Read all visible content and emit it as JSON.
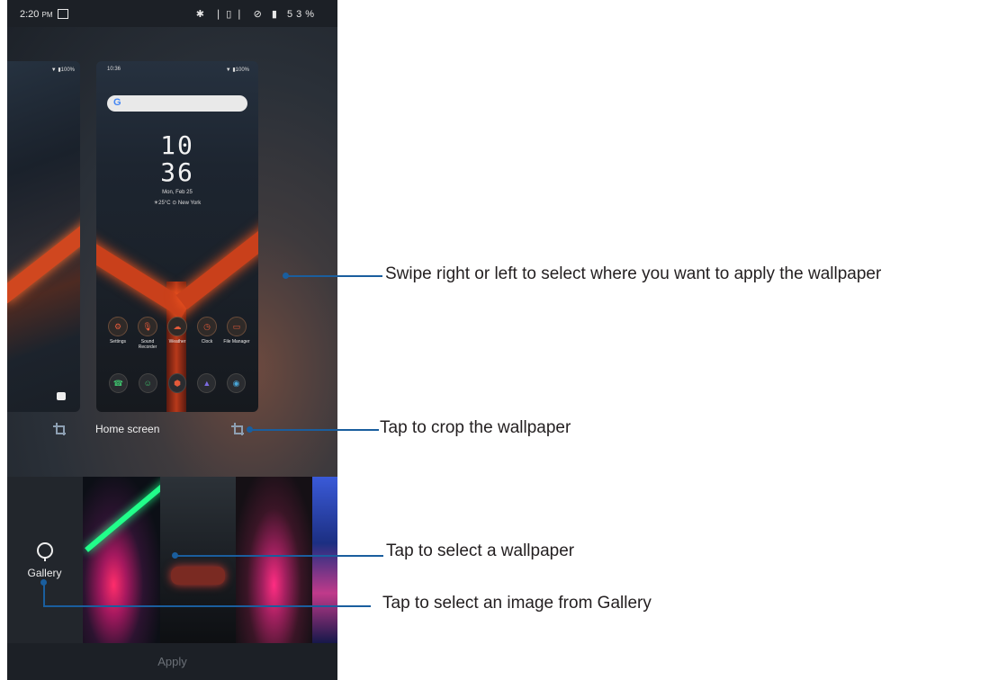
{
  "status_bar": {
    "time": "2:20",
    "ampm": "PM",
    "bluetooth": "✱",
    "vibrate": "❘▯❘",
    "no_sim": "⊘",
    "battery_pct": "53%"
  },
  "lock_preview": {
    "status": "▼ ▮100%",
    "camera_icon": "camera-icon"
  },
  "home_preview": {
    "status_time": "10:36",
    "status_right": "▼ ▮100%",
    "search_logo": "G",
    "clock_hours": "10",
    "clock_minutes": "36",
    "date": "Mon, Feb 25",
    "weather": "☀25°C ⊙ New York",
    "apps": [
      {
        "label": "Settings",
        "glyph": "⚙",
        "icon": "gear-icon"
      },
      {
        "label": "Sound Recorder",
        "glyph": "🎙",
        "icon": "microphone-icon"
      },
      {
        "label": "Weather",
        "glyph": "☁",
        "icon": "weather-icon"
      },
      {
        "label": "Clock",
        "glyph": "◷",
        "icon": "clock-icon"
      },
      {
        "label": "File Manager",
        "glyph": "▭",
        "icon": "folder-icon"
      }
    ],
    "dock": [
      {
        "glyph": "☎",
        "icon": "phone-icon",
        "color": "#3dbb6a"
      },
      {
        "glyph": "☺",
        "icon": "contacts-icon",
        "color": "#3dbb6a"
      },
      {
        "glyph": "⬢",
        "icon": "rog-icon",
        "color": "#e35a3a"
      },
      {
        "glyph": "▲",
        "icon": "gallery-icon",
        "color": "#7b6adf"
      },
      {
        "glyph": "◉",
        "icon": "camera-icon",
        "color": "#49a6d8"
      }
    ]
  },
  "preview_label": "Home screen",
  "gallery_label": "Gallery",
  "apply_label": "Apply",
  "callouts": {
    "swipe": "Swipe right or left to select where you want to apply the wallpaper",
    "crop": "Tap to crop the wallpaper",
    "select": "Tap to select a wallpaper",
    "gallery": "Tap to select an image from Gallery"
  },
  "colors": {
    "callout": "#1a5e9e",
    "accent_red": "#c9401b"
  }
}
